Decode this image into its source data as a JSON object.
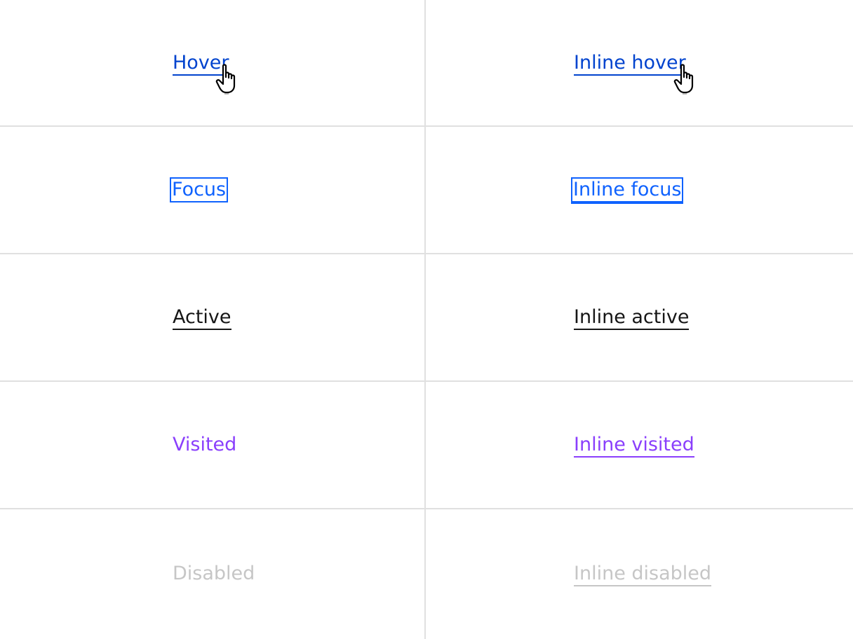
{
  "links": {
    "hover": "Hover",
    "inline_hover": "Inline hover",
    "focus": "Focus",
    "inline_focus": "Inline focus",
    "active": "Active",
    "inline_active": "Inline active",
    "visited": "Visited",
    "inline_visited": "Inline visited",
    "disabled": "Disabled",
    "inline_disabled": "Inline disabled"
  },
  "colors": {
    "hover": "#0043ce",
    "focus": "#0f62fe",
    "active": "#161616",
    "visited": "#8a3ffc",
    "disabled": "#c6c6c6",
    "divider": "#e0e0e0"
  },
  "icons": {
    "cursor": "hand-pointer-icon"
  }
}
